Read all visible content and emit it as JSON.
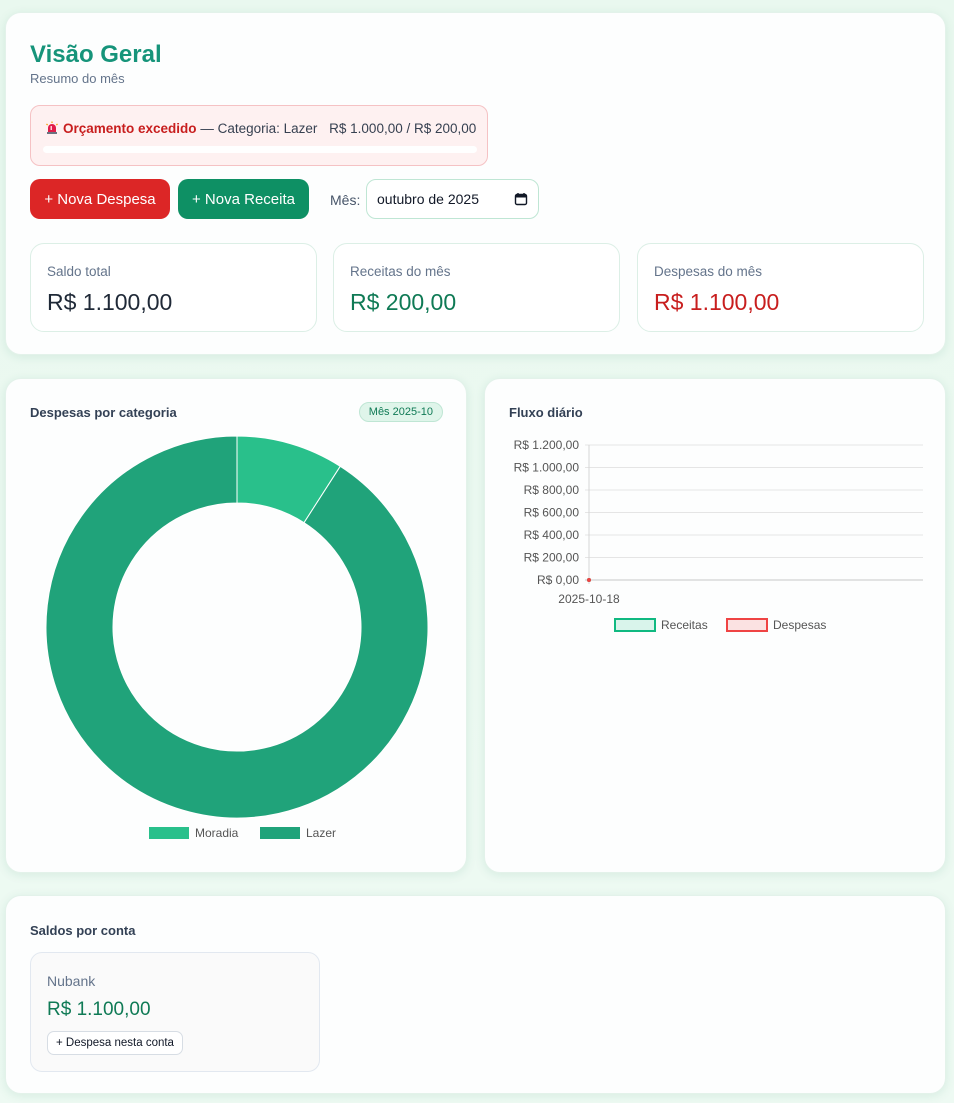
{
  "header": {
    "title": "Visão Geral",
    "subtitle": "Resumo do mês"
  },
  "alert": {
    "icon": "siren-icon",
    "title": "Orçamento excedido",
    "separator": "—",
    "category_text": "Categoria: Lazer",
    "amount_text": "R$ 1.000,00 / R$ 200,00",
    "progress_percent": 100,
    "color": "#dc2626"
  },
  "actions": {
    "new_expense": "+ Nova Despesa",
    "new_income": "+ Nova Receita",
    "month_label": "Mês:",
    "month_value": "outubro de 2025"
  },
  "stats": [
    {
      "label": "Saldo total",
      "value": "R$ 1.100,00"
    },
    {
      "label": "Receitas do mês",
      "value": "R$ 200,00"
    },
    {
      "label": "Despesas do mês",
      "value": "R$ 1.100,00"
    }
  ],
  "category_panel": {
    "title": "Despesas por categoria",
    "badge": "Mês 2025-10"
  },
  "flux_panel": {
    "title": "Fluxo diário"
  },
  "accounts_panel": {
    "title": "Saldos por conta",
    "accounts": [
      {
        "name": "Nubank",
        "balance": "R$ 1.100,00",
        "action": "+ Despesa nesta conta"
      }
    ]
  },
  "colors": {
    "brand_green": "#16947a",
    "receitas": "#10b981",
    "despesas": "#ef4444",
    "moradia": "#29c08b",
    "lazer": "#20a37a"
  },
  "chart_data": [
    {
      "type": "pie",
      "variant": "doughnut",
      "categories": [
        "Moradia",
        "Lazer"
      ],
      "values": [
        100,
        1000
      ],
      "colors": [
        "#29c08b",
        "#20a37a"
      ],
      "legend": "bottom"
    },
    {
      "type": "line",
      "x": [
        "2025-10-18"
      ],
      "series": [
        {
          "name": "Receitas",
          "values": [
            0
          ],
          "color": "#10b981"
        },
        {
          "name": "Despesas",
          "values": [
            0
          ],
          "color": "#ef4444"
        }
      ],
      "yticks": [
        "R$ 0,00",
        "R$ 200,00",
        "R$ 400,00",
        "R$ 600,00",
        "R$ 800,00",
        "R$ 1.000,00",
        "R$ 1.200,00"
      ],
      "ylim": [
        0,
        1200
      ],
      "grid": true,
      "legend": "bottom"
    }
  ]
}
